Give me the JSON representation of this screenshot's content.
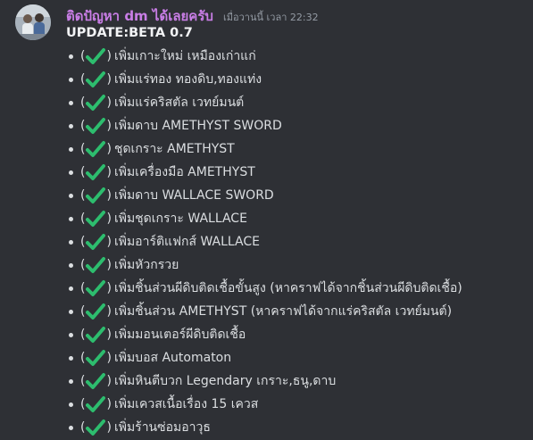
{
  "message": {
    "username": "ติดปัญหา dm ได้เลยครับ",
    "timestamp": "เมื่อวานนี้ เวลา 22:32",
    "title": "UPDATE:BETA 0.7",
    "open_paren": "(",
    "close_paren": ")",
    "check_icon": "heavy-check-mark-icon",
    "check_color": "#2dbd6e",
    "username_color": "#c97ee6",
    "items": [
      "เพิ่มเกาะใหม่ เหมืองเก่าแก่",
      "เพิ่มแร่ทอง ทองดิบ,ทองแท่ง",
      "เพิ่มแร่คริสตัล เวทย์มนต์",
      "เพิ่มดาบ AMETHYST SWORD",
      "ชุดเกราะ AMETHYST",
      "เพิ่มเครื่องมือ AMETHYST",
      "เพิ่มดาบ WALLACE SWORD",
      "เพิ่มชุดเกราะ WALLACE",
      "เพิ่มอาร์ติแฟกส์ WALLACE",
      "เพิ่มหัวกรวย",
      "เพิ่มชิ้นส่วนผีดิบติดเชื้อขั้นสูง (หาคราฟได้จากชิ้นส่วนผีดิบติดเชื้อ)",
      "เพิ่มชิ้นส่วน AMETHYST (หาคราฟได้จากแร่คริสตัล เวทย์มนต์)",
      "เพิ่มมอนเตอร์ผีดิบติดเชื้อ",
      "เพิ่มบอส Automaton",
      "เพิ่มหินตีบวก Legendary เกราะ,ธนู,ดาบ",
      "เพิ่มเควสเนื้อเรื่อง 15 เควส",
      "เพิ่มร้านซ่อมอาวุธ"
    ]
  }
}
